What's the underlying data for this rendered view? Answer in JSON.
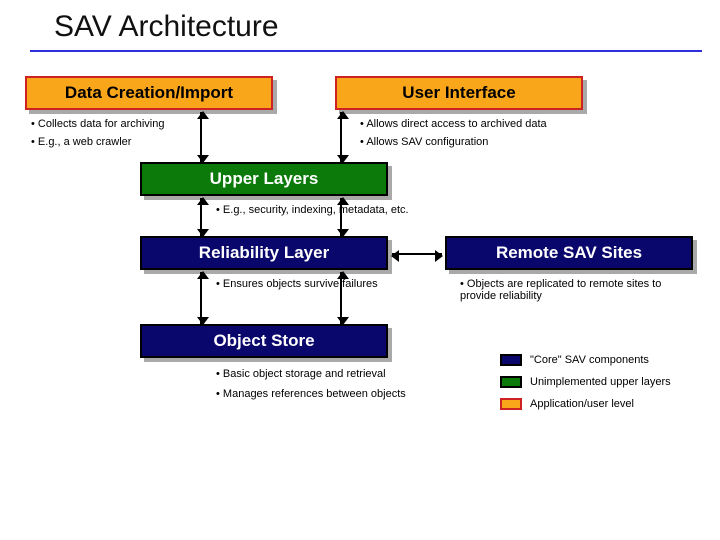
{
  "title": "SAV Architecture",
  "blocks": {
    "data_creation": {
      "label": "Data Creation/Import"
    },
    "user_interface": {
      "label": "User Interface"
    },
    "upper_layers": {
      "label": "Upper Layers"
    },
    "reliability": {
      "label": "Reliability Layer"
    },
    "remote_sites": {
      "label": "Remote SAV Sites"
    },
    "object_store": {
      "label": "Object Store"
    }
  },
  "bullets": {
    "dc0": "Collects data for archiving",
    "dc1": "E.g., a web crawler",
    "ui0": "Allows direct access to archived data",
    "ui1": "Allows SAV configuration",
    "ul0": "E.g., security, indexing, metadata, etc.",
    "rl0": "Ensures objects survive failures",
    "rs0": "Objects are replicated to remote sites to provide reliability",
    "os0": "Basic object storage and retrieval",
    "os1": "Manages references between objects"
  },
  "legend": {
    "core": "\"Core\" SAV components",
    "unimpl": "Unimplemented upper layers",
    "appusr": "Application/user level"
  }
}
